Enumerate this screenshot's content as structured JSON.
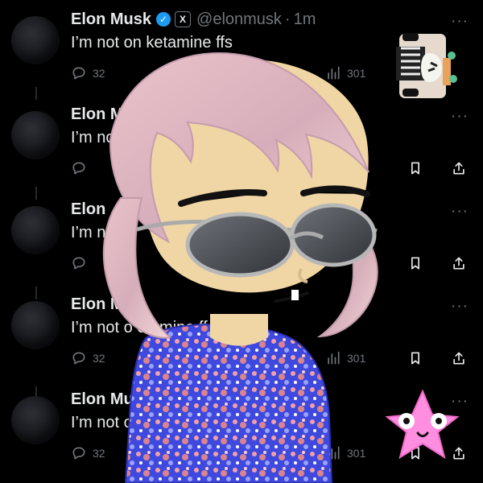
{
  "timeline": {
    "tweets": [
      {
        "author": "Elon Musk",
        "handle": "@elonmusk",
        "separator": "·",
        "time": "1m",
        "text": "I’m not on ketamine ffs",
        "replies": "32",
        "views": "301"
      },
      {
        "author": "Elon Mu",
        "text": "I’m no"
      },
      {
        "author": "Elon",
        "text": "I’m not"
      },
      {
        "author": "Elon M",
        "text": "I’m not o etamine ff",
        "replies": "32",
        "views": "301"
      },
      {
        "author": "Elon Musk",
        "text": "I’m not on",
        "replies": "32",
        "views": "301"
      }
    ]
  },
  "icons": {
    "verified": "verified-check-icon",
    "x_badge": "x-logo-icon",
    "reply": "reply-icon",
    "retweet": "retweet-icon",
    "views": "views-icon",
    "bookmark": "bookmark-icon",
    "share": "share-icon",
    "more": "more-icon"
  },
  "glyphs": {
    "verified": "✓",
    "x_badge": "X",
    "more": "···"
  },
  "colors": {
    "background": "#000000",
    "text": "#e7e9ea",
    "muted": "#71767b",
    "verified": "#1d9bf0",
    "sticker_star": "#ff8ee0"
  }
}
